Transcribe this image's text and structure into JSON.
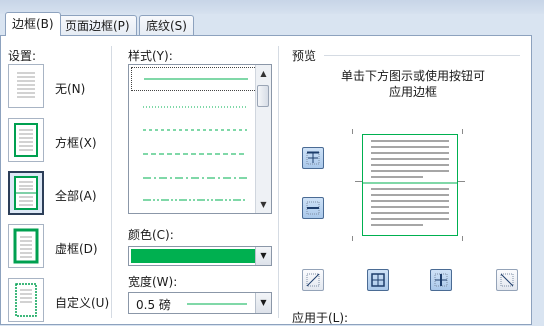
{
  "tabs": {
    "borders": "边框(B)",
    "page_border": "页面边框(P)",
    "shading": "底纹(S)"
  },
  "settings": {
    "title": "设置:",
    "items": [
      {
        "label": "无(N)",
        "icon": "border-none-icon"
      },
      {
        "label": "方框(X)",
        "icon": "border-box-icon"
      },
      {
        "label": "全部(A)",
        "icon": "border-all-icon"
      },
      {
        "label": "虚框(D)",
        "icon": "border-grid-icon"
      },
      {
        "label": "自定义(U)",
        "icon": "border-custom-icon"
      }
    ],
    "selected_index": 2
  },
  "style": {
    "title": "样式(Y):",
    "items": [
      "solid",
      "dotted",
      "dashed",
      "dashed-wide",
      "dash-dot",
      "dash-dot-dot"
    ],
    "selected_index": 0
  },
  "color": {
    "title": "颜色(C):",
    "value": "#00b050"
  },
  "width": {
    "title": "宽度(W):",
    "value": "0.5 磅"
  },
  "preview": {
    "title": "预览",
    "hint": "单击下方图示或使用按钮可应用边框",
    "apply_to": "应用于(L):"
  },
  "colors": {
    "accent_border": "#00b050",
    "selected_setting": "#2c3e58",
    "text_line": "#a6a6a6"
  }
}
